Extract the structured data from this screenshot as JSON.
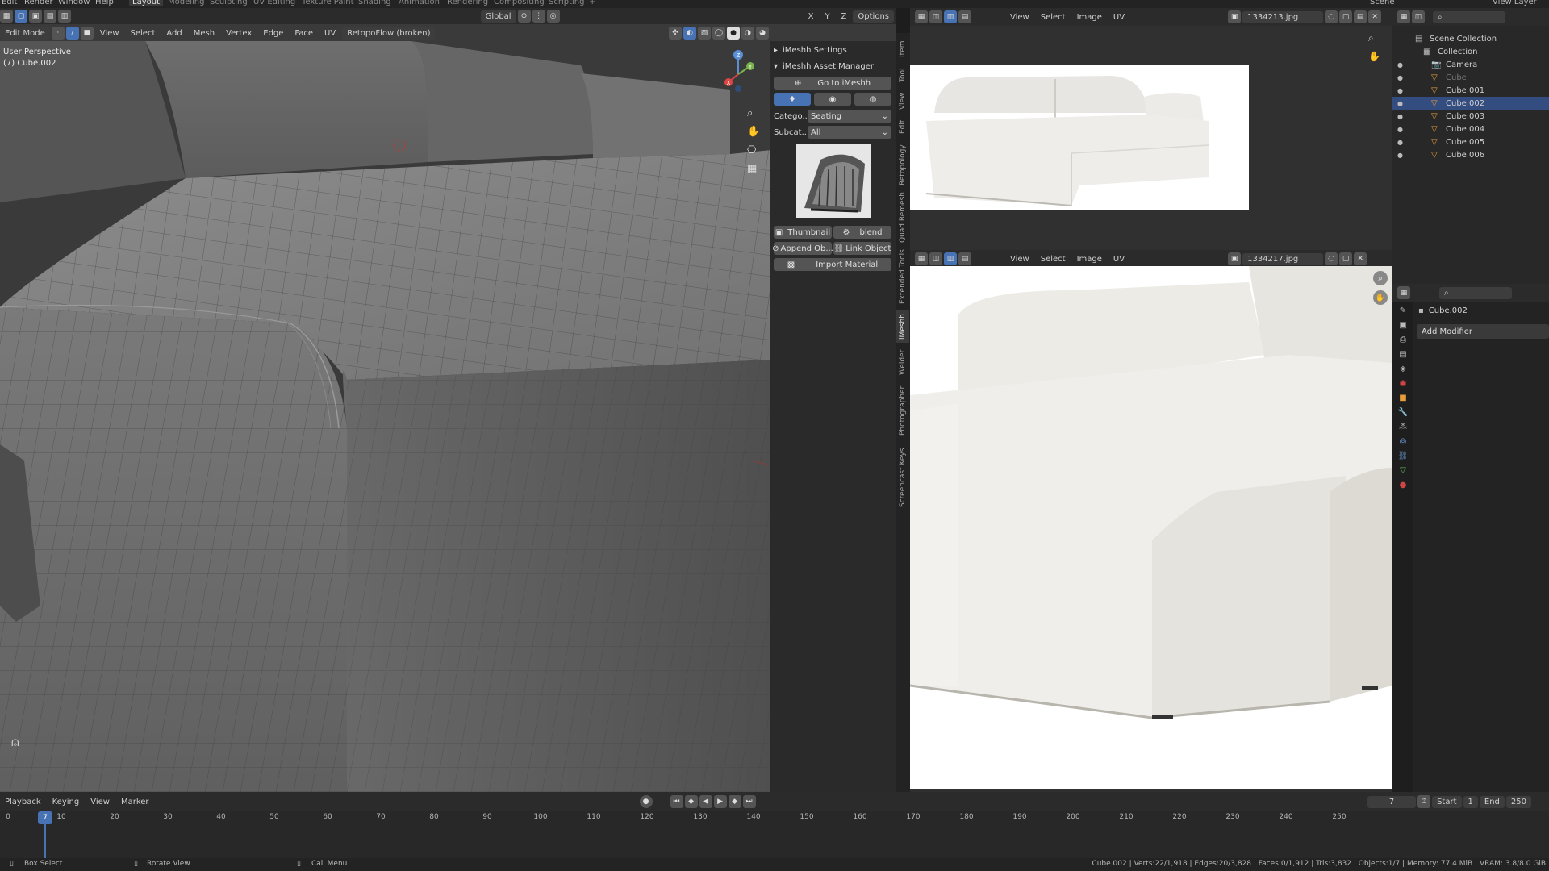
{
  "topbar": {
    "menus": [
      "Edit",
      "Render",
      "Window",
      "Help"
    ],
    "workspaces": [
      "Layout",
      "Modeling",
      "Sculpting",
      "UV Editing",
      "Texture Paint",
      "Shading",
      "Animation",
      "Rendering",
      "Compositing",
      "Scripting",
      "+"
    ],
    "active_workspace": "Layout",
    "scene": "Scene",
    "view_layer": "View Layer"
  },
  "viewport": {
    "mode": "Edit Mode",
    "transform_orientation": "Global",
    "menus": [
      "View",
      "Select",
      "Add",
      "Mesh",
      "Vertex",
      "Edge",
      "Face",
      "UV"
    ],
    "retopo_dropdown": "RetopoFlow (broken)",
    "options": "Options",
    "axis_labels": [
      "X",
      "Y",
      "Z"
    ],
    "info_line1": "User Perspective",
    "info_line2": "(7) Cube.002",
    "gizmo_labels": {
      "z": "Z",
      "y": "Y",
      "x": "X"
    }
  },
  "npanel": {
    "settings_title": "iMeshh Settings",
    "asset_manager_title": "iMeshh Asset Manager",
    "go_to": "Go to iMeshh",
    "category_label": "Catego...",
    "category_value": "Seating",
    "subcategory_label": "Subcat...",
    "subcategory_value": "All",
    "thumbnail_btn": "Thumbnail",
    "blend_btn": "blend",
    "append_btn": "Append Ob...",
    "link_btn": "Link Object",
    "import_btn": "Import Material",
    "tabs": [
      "Item",
      "Tool",
      "View",
      "Edit",
      "Retopology",
      "Quad Remesh",
      "Extended Tools",
      "iMeshh",
      "Welder",
      "Photographer",
      "Screencast Keys"
    ],
    "active_tab": "iMeshh"
  },
  "image_editor_1": {
    "menus": [
      "View",
      "Select",
      "Image",
      "UV"
    ],
    "image_name": "1334213.jpg"
  },
  "image_editor_2": {
    "menus": [
      "View",
      "Select",
      "Image",
      "UV"
    ],
    "image_name": "1334217.jpg"
  },
  "outliner": {
    "rows": [
      {
        "label": "Scene Collection",
        "indent": 0
      },
      {
        "label": "Collection",
        "indent": 1
      },
      {
        "label": "Camera",
        "indent": 2
      },
      {
        "label": "Cube",
        "indent": 2
      },
      {
        "label": "Cube.001",
        "indent": 2
      },
      {
        "label": "Cube.002",
        "indent": 2,
        "selected": true
      },
      {
        "label": "Cube.003",
        "indent": 2
      },
      {
        "label": "Cube.004",
        "indent": 2
      },
      {
        "label": "Cube.005",
        "indent": 2
      },
      {
        "label": "Cube.006",
        "indent": 2
      }
    ]
  },
  "properties": {
    "object_name": "Cube.002",
    "add_modifier": "Add Modifier"
  },
  "timeline": {
    "menus": [
      "Playback",
      "Keying",
      "View",
      "Marker"
    ],
    "current_frame": "7",
    "start_label": "Start",
    "start_value": "1",
    "end_label": "End",
    "end_value": "250",
    "ticks": [
      "0",
      "10",
      "20",
      "30",
      "40",
      "50",
      "60",
      "70",
      "80",
      "90",
      "100",
      "110",
      "120",
      "130",
      "140",
      "150",
      "160",
      "170",
      "180",
      "190",
      "200",
      "210",
      "220",
      "230",
      "240",
      "250"
    ]
  },
  "statusbar": {
    "left1": "Box Select",
    "left2": "Rotate View",
    "left3": "Call Menu",
    "stats": "Cube.002 | Verts:22/1,918 | Edges:20/3,828 | Faces:0/1,912 | Tris:3,832 | Objects:1/7 | Memory: 77.4 MiB | VRAM: 3.8/8.0 GiB"
  },
  "colors": {
    "accent": "#4772b3",
    "selected_row": "#334d80",
    "viewport_bg": "#3a3a3a"
  }
}
